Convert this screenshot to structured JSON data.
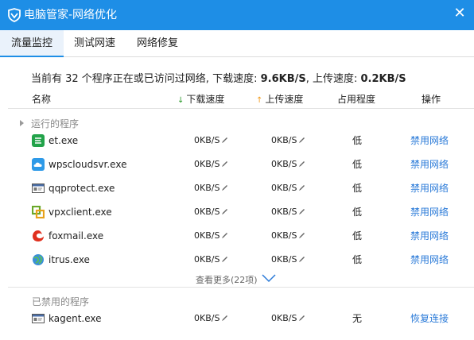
{
  "window": {
    "title": "电脑管家-网络优化",
    "close_glyph": "✕"
  },
  "tabs": [
    {
      "label": "流量监控",
      "active": true
    },
    {
      "label": "测试网速",
      "active": false
    },
    {
      "label": "网络修复",
      "active": false
    }
  ],
  "summary": {
    "prefix": "当前有 32 个程序正在或已访问过网络, 下载速度: ",
    "download": "9.6KB/S",
    "middle": ", 上传速度: ",
    "upload": "0.2KB/S"
  },
  "columns": {
    "name": "名称",
    "download": "下载速度",
    "upload": "上传速度",
    "usage": "占用程度",
    "action": "操作"
  },
  "running": {
    "label": "运行的程序",
    "rows": [
      {
        "name": "et.exe",
        "icon": "wps-et-icon",
        "download": "0KB/S",
        "upload": "0KB/S",
        "usage": "低",
        "action": "禁用网络"
      },
      {
        "name": "wpscloudsvr.exe",
        "icon": "wps-cloud-icon",
        "download": "0KB/S",
        "upload": "0KB/S",
        "usage": "低",
        "action": "禁用网络"
      },
      {
        "name": "qqprotect.exe",
        "icon": "qqprotect-icon",
        "download": "0KB/S",
        "upload": "0KB/S",
        "usage": "低",
        "action": "禁用网络"
      },
      {
        "name": "vpxclient.exe",
        "icon": "vmware-vpxclient-icon",
        "download": "0KB/S",
        "upload": "0KB/S",
        "usage": "低",
        "action": "禁用网络"
      },
      {
        "name": "foxmail.exe",
        "icon": "foxmail-icon",
        "download": "0KB/S",
        "upload": "0KB/S",
        "usage": "低",
        "action": "禁用网络"
      },
      {
        "name": "itrus.exe",
        "icon": "itrus-globe-icon",
        "download": "0KB/S",
        "upload": "0KB/S",
        "usage": "低",
        "action": "禁用网络"
      }
    ],
    "more": "查看更多(22项)"
  },
  "disabled": {
    "label": "已禁用的程序",
    "rows": [
      {
        "name": "kagent.exe",
        "icon": "kagent-window-icon",
        "download": "0KB/S",
        "upload": "0KB/S",
        "usage": "无",
        "action": "恢复连接"
      }
    ]
  },
  "colors": {
    "titlebar": "#1e8ee6",
    "link": "#2a7ad8",
    "download_arrow": "#2a9a2a",
    "upload_arrow": "#f29a1a"
  }
}
